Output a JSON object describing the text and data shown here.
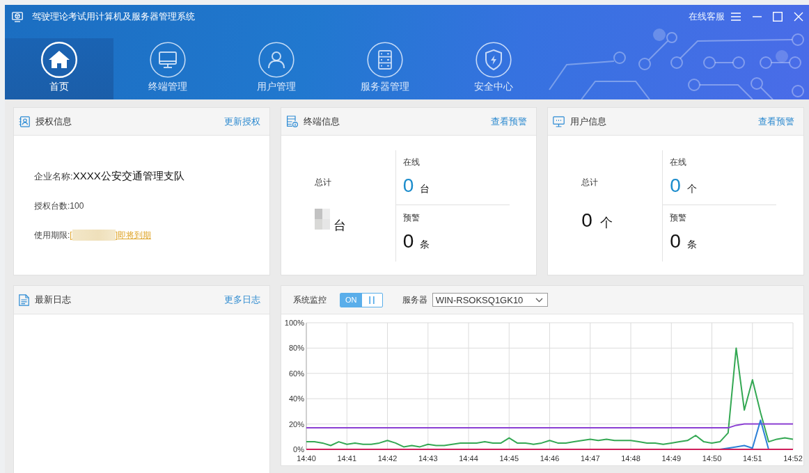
{
  "window": {
    "title": "驾驶理论考试用计算机及服务器管理系统",
    "support_link": "在线客服"
  },
  "nav_tabs": [
    {
      "label": "首页",
      "selected": true
    },
    {
      "label": "终端管理",
      "selected": false
    },
    {
      "label": "用户管理",
      "selected": false
    },
    {
      "label": "服务器管理",
      "selected": false
    },
    {
      "label": "安全中心",
      "selected": false
    }
  ],
  "auth_card": {
    "title": "授权信息",
    "action": "更新授权",
    "company": {
      "label": "企业名称:",
      "value": "XXXX公安交通管理支队"
    },
    "license_count": "授权台数:100",
    "expiry": {
      "label": "使用期限:",
      "open": "[",
      "redacted": true,
      "status": "]即将到期"
    }
  },
  "terminal_card": {
    "title": "终端信息",
    "action": "查看预警",
    "total": {
      "label": "总计",
      "redacted": true,
      "unit": "台"
    },
    "online": {
      "label": "在线",
      "value": "0",
      "unit": "台"
    },
    "alerts": {
      "label": "预警",
      "value": "0",
      "unit": "条"
    }
  },
  "user_card": {
    "title": "用户信息",
    "action": "查看预警",
    "total": {
      "label": "总计",
      "redacted": false,
      "value": "0",
      "unit": "个"
    },
    "online": {
      "label": "在线",
      "value": "0",
      "unit": "个"
    },
    "alerts": {
      "label": "预警",
      "value": "0",
      "unit": "条"
    }
  },
  "log_card": {
    "title": "最新日志",
    "action": "更多日志"
  },
  "monitor_card": {
    "title": "系统监控",
    "toggle": {
      "on": true,
      "label": "ON"
    },
    "server_label": "服务器",
    "server_value": "WIN-RSOKSQ1GK10",
    "chart_data": {
      "type": "line",
      "grid": true,
      "categories": [
        "14:40",
        null,
        null,
        null,
        null,
        "14:41",
        null,
        null,
        null,
        null,
        "14:42",
        null,
        null,
        null,
        null,
        "14:43",
        null,
        null,
        null,
        null,
        "14:44",
        null,
        null,
        null,
        null,
        "14:45",
        null,
        null,
        null,
        null,
        "14:46",
        null,
        null,
        null,
        null,
        "14:47",
        null,
        null,
        null,
        null,
        "14:48",
        null,
        null,
        null,
        null,
        "14:49",
        null,
        null,
        null,
        null,
        "14:50",
        null,
        null,
        null,
        null,
        "14:51",
        null,
        null,
        null,
        null,
        "14:52"
      ],
      "ylim": [
        0,
        100
      ],
      "yticks": [
        {
          "value": 0,
          "label": "0%"
        },
        {
          "value": 20,
          "label": "20%"
        },
        {
          "value": 40,
          "label": "40%"
        },
        {
          "value": 60,
          "label": "60%"
        },
        {
          "value": 80,
          "label": "80%"
        },
        {
          "value": 100,
          "label": "100%"
        }
      ],
      "series": [
        {
          "color": "#34a853",
          "values": [
            6,
            6,
            5,
            3,
            6,
            4,
            5,
            4,
            4,
            5,
            7,
            5,
            2,
            3,
            2,
            4,
            3,
            3,
            4,
            5,
            5,
            5,
            6,
            5,
            5,
            9,
            5,
            5,
            4,
            5,
            7,
            5,
            5,
            6,
            7,
            8,
            7,
            8,
            7,
            7,
            7,
            6,
            5,
            5,
            4,
            5,
            6,
            7,
            11,
            6,
            5,
            6,
            13,
            80,
            31,
            55,
            29,
            6,
            8,
            9,
            8
          ]
        },
        {
          "color": "#8b3fd3",
          "values": [
            17,
            17,
            17,
            17,
            17,
            17,
            17,
            17,
            17,
            17,
            17,
            17,
            17,
            17,
            17,
            17,
            17,
            17,
            17,
            17,
            17,
            17,
            17,
            17,
            17,
            17,
            17,
            17,
            17,
            17,
            17,
            17,
            17,
            17,
            17,
            17,
            17,
            17,
            17,
            17,
            17,
            17,
            17,
            17,
            17,
            17,
            17,
            17,
            17,
            17,
            17,
            17,
            17,
            19,
            20,
            20,
            20,
            20,
            20,
            20,
            20
          ]
        },
        {
          "color": "#2c7fd6",
          "values": [
            null,
            null,
            null,
            null,
            null,
            null,
            null,
            null,
            null,
            null,
            null,
            null,
            null,
            null,
            null,
            null,
            null,
            null,
            null,
            null,
            null,
            null,
            null,
            null,
            null,
            null,
            null,
            null,
            null,
            null,
            null,
            null,
            null,
            null,
            null,
            null,
            null,
            null,
            null,
            null,
            null,
            null,
            null,
            null,
            null,
            null,
            null,
            null,
            null,
            null,
            null,
            0,
            1,
            2,
            3,
            1,
            23,
            0,
            null,
            null,
            null
          ]
        },
        {
          "color": "#cf1f5b",
          "values": [
            0,
            0,
            0,
            0,
            0,
            0,
            0,
            0,
            0,
            0,
            0,
            0,
            0,
            0,
            0,
            0,
            0,
            0,
            0,
            0,
            0,
            0,
            0,
            0,
            0,
            0,
            0,
            0,
            0,
            0,
            0,
            0,
            0,
            0,
            0,
            0,
            0,
            0,
            0,
            0,
            0,
            0,
            0,
            0,
            0,
            0,
            0,
            0,
            0,
            0,
            0,
            0,
            0,
            0,
            0,
            0,
            0,
            0,
            0,
            0,
            0
          ]
        }
      ]
    }
  }
}
